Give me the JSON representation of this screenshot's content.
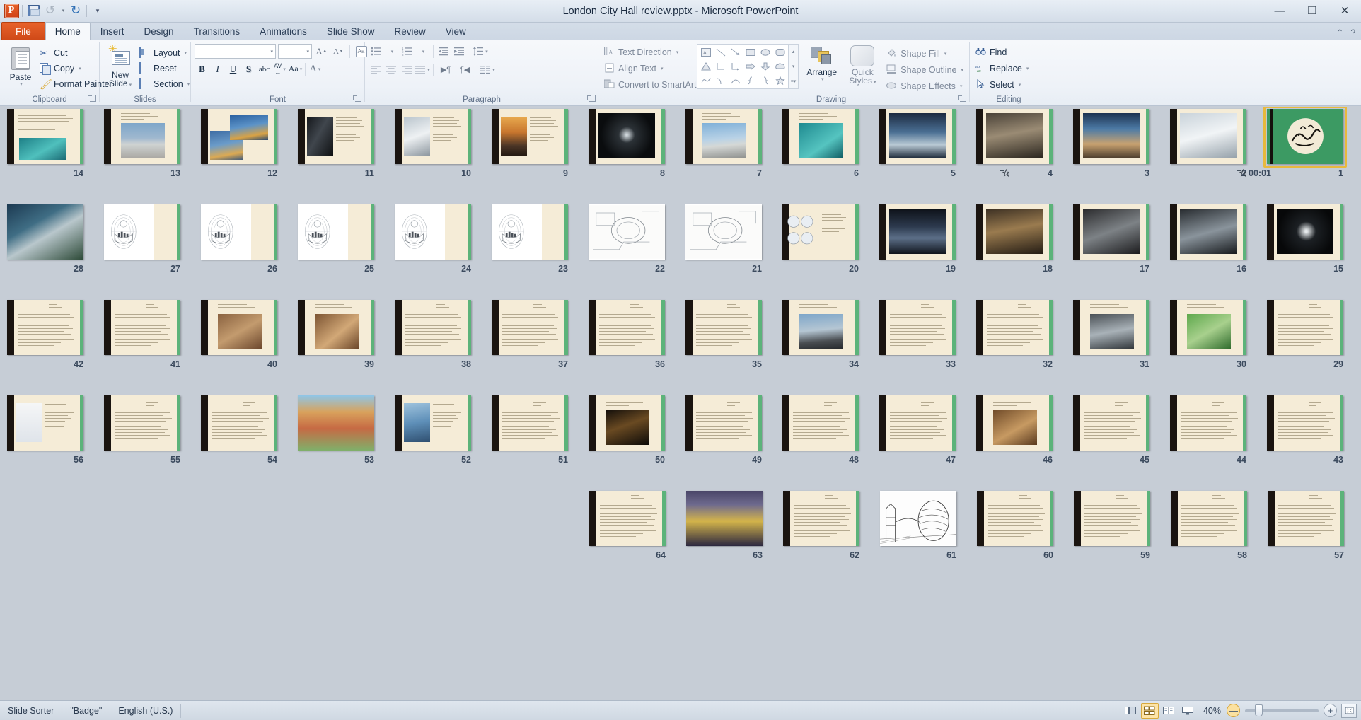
{
  "window": {
    "title": "London City Hall review.pptx  -  Microsoft PowerPoint",
    "minimize": "—",
    "restore": "❐",
    "close": "✕"
  },
  "quick_access": {
    "app_logo": "P",
    "save": "save-icon",
    "undo": "↺",
    "redo": "↻",
    "customize": "▾"
  },
  "tabs": [
    {
      "label": "File",
      "kind": "file"
    },
    {
      "label": "Home",
      "kind": "active"
    },
    {
      "label": "Insert",
      "kind": "normal"
    },
    {
      "label": "Design",
      "kind": "normal"
    },
    {
      "label": "Transitions",
      "kind": "normal"
    },
    {
      "label": "Animations",
      "kind": "normal"
    },
    {
      "label": "Slide Show",
      "kind": "normal"
    },
    {
      "label": "Review",
      "kind": "normal"
    },
    {
      "label": "View",
      "kind": "normal"
    }
  ],
  "tab_right": {
    "minimize_ribbon": "⌃",
    "help": "?"
  },
  "ribbon": {
    "clipboard": {
      "label": "Clipboard",
      "paste": "Paste",
      "paste_caret": "▾",
      "cut": "Cut",
      "copy": "Copy",
      "format_painter": "Format Painter"
    },
    "slides": {
      "label": "Slides",
      "new_slide": "New\nSlide",
      "new_slide_line1": "New",
      "new_slide_line2": "Slide",
      "layout": "Layout",
      "reset": "Reset",
      "section": "Section"
    },
    "font": {
      "label": "Font",
      "font_name": "",
      "font_size": "",
      "grow": "A",
      "shrink": "A",
      "clear_formatting": "Aa",
      "bold": "B",
      "italic": "I",
      "underline": "U",
      "shadow": "S",
      "strikethrough": "abc",
      "character_spacing": "AV",
      "change_case": "Aa",
      "font_color": "A"
    },
    "paragraph": {
      "label": "Paragraph",
      "bullets": "bullets-icon",
      "numbering": "numbering-icon",
      "decrease_indent": "decrease-indent-icon",
      "increase_indent": "increase-indent-icon",
      "line_spacing": "line-spacing-icon",
      "align_left": "align-left-icon",
      "align_center": "align-center-icon",
      "align_right": "align-right-icon",
      "justify": "justify-icon",
      "ltr": "▶¶",
      "rtl": "¶◀",
      "columns": "columns-icon",
      "text_direction": "Text Direction",
      "align_text": "Align Text",
      "convert_to_smartart": "Convert to SmartArt"
    },
    "drawing": {
      "label": "Drawing",
      "shapes": [
        "▭",
        "╲",
        "↘",
        "▢",
        "⬭",
        "▢",
        "△",
        "⌐",
        "⌐",
        "⇨",
        "⇩",
        "☁",
        "∿",
        "⌒",
        "{",
        "}",
        "☆",
        "◇"
      ],
      "scroll_up": "▴",
      "scroll_down": "▾",
      "scroll_more": "▾",
      "arrange": "Arrange",
      "quick_styles_line1": "Quick",
      "quick_styles_line2": "Styles",
      "shape_fill": "Shape Fill",
      "shape_outline": "Shape Outline",
      "shape_effects": "Shape Effects"
    },
    "editing": {
      "label": "Editing",
      "find": "Find",
      "replace": "Replace",
      "select": "Select"
    }
  },
  "status_bar": {
    "view_name": "Slide Sorter",
    "theme": "\"Badge\"",
    "language": "English (U.S.)",
    "views": [
      {
        "name": "normal-view",
        "glyph": "▯▤",
        "active": false
      },
      {
        "name": "slide-sorter-view",
        "glyph": "▦",
        "active": true
      },
      {
        "name": "reading-view",
        "glyph": "▤",
        "active": false
      },
      {
        "name": "slide-show-view",
        "glyph": "▭",
        "active": false
      }
    ],
    "zoom_level": "40%",
    "zoom_out": "—",
    "zoom_in": "+",
    "fit_to_window": "⤢"
  },
  "slide_sorter": {
    "selected_slide": 1,
    "selected_timing": "00:01",
    "transition_icon": "✦",
    "slides": [
      {
        "n": 14,
        "type": "text-image",
        "img": "teal",
        "imgpos": "bottom"
      },
      {
        "n": 13,
        "type": "text-image",
        "img": "cityhall-day",
        "imgpos": "center"
      },
      {
        "n": 12,
        "type": "text-image",
        "img": "cityhall-blue",
        "imgpos": "split"
      },
      {
        "n": 11,
        "type": "text-image",
        "img": "steel-dark",
        "imgpos": "left"
      },
      {
        "n": 10,
        "type": "text-image",
        "img": "glass-egg",
        "imgpos": "left"
      },
      {
        "n": 9,
        "type": "text-image",
        "img": "sunset-walk",
        "imgpos": "left"
      },
      {
        "n": 8,
        "type": "image-dark",
        "img": "spiral-dark",
        "imgpos": "center"
      },
      {
        "n": 7,
        "type": "text-image",
        "img": "cityhall-sky",
        "imgpos": "center"
      },
      {
        "n": 6,
        "type": "text-image",
        "img": "teal-plan",
        "imgpos": "center"
      },
      {
        "n": 5,
        "type": "image-dark",
        "img": "cityhall-night",
        "imgpos": "center"
      },
      {
        "n": 4,
        "type": "image-dark",
        "img": "interior-hall",
        "imgpos": "center"
      },
      {
        "n": 3,
        "type": "image-dark",
        "img": "bridge-sky",
        "imgpos": "center"
      },
      {
        "n": 2,
        "type": "image-dark",
        "img": "interior-white",
        "imgpos": "center"
      },
      {
        "n": 1,
        "type": "title-green",
        "img": "calligraphy",
        "imgpos": "center"
      },
      {
        "n": 28,
        "type": "image-full",
        "img": "aerial-dome",
        "imgpos": "full"
      },
      {
        "n": 27,
        "type": "diagram",
        "img": "wire-1",
        "imgpos": "left"
      },
      {
        "n": 26,
        "type": "diagram",
        "img": "wire-2",
        "imgpos": "left"
      },
      {
        "n": 25,
        "type": "diagram",
        "img": "wire-3",
        "imgpos": "left"
      },
      {
        "n": 24,
        "type": "diagram",
        "img": "wire-4",
        "imgpos": "left"
      },
      {
        "n": 23,
        "type": "diagram",
        "img": "wire-5",
        "imgpos": "left"
      },
      {
        "n": 22,
        "type": "plan",
        "img": "site-plan",
        "imgpos": "full"
      },
      {
        "n": 21,
        "type": "plan",
        "img": "axon-plan",
        "imgpos": "full"
      },
      {
        "n": 20,
        "type": "text-image",
        "img": "circles",
        "imgpos": "left"
      },
      {
        "n": 19,
        "type": "image-dark",
        "img": "auditorium",
        "imgpos": "center"
      },
      {
        "n": 18,
        "type": "image-dark",
        "img": "interior-warm",
        "imgpos": "center"
      },
      {
        "n": 17,
        "type": "image-dark",
        "img": "stair-interior",
        "imgpos": "center"
      },
      {
        "n": 16,
        "type": "image-dark",
        "img": "ramp-interior",
        "imgpos": "center"
      },
      {
        "n": 15,
        "type": "image-dark",
        "img": "spiral-black",
        "imgpos": "center"
      },
      {
        "n": 42,
        "type": "text",
        "img": "",
        "imgpos": ""
      },
      {
        "n": 41,
        "type": "text",
        "img": "",
        "imgpos": ""
      },
      {
        "n": 40,
        "type": "text-image",
        "img": "brown-model",
        "imgpos": "center"
      },
      {
        "n": 39,
        "type": "text-image",
        "img": "brown-wood",
        "imgpos": "center"
      },
      {
        "n": 38,
        "type": "text",
        "img": "",
        "imgpos": ""
      },
      {
        "n": 37,
        "type": "text",
        "img": "",
        "imgpos": ""
      },
      {
        "n": 36,
        "type": "text",
        "img": "",
        "imgpos": ""
      },
      {
        "n": 35,
        "type": "text",
        "img": "",
        "imgpos": ""
      },
      {
        "n": 34,
        "type": "text-image",
        "img": "cityhall-grey",
        "imgpos": "center"
      },
      {
        "n": 33,
        "type": "text",
        "img": "",
        "imgpos": ""
      },
      {
        "n": 32,
        "type": "text",
        "img": "",
        "imgpos": ""
      },
      {
        "n": 31,
        "type": "text-image",
        "img": "interior-photo",
        "imgpos": "center"
      },
      {
        "n": 30,
        "type": "text-image",
        "img": "green-render",
        "imgpos": "center"
      },
      {
        "n": 29,
        "type": "text",
        "img": "",
        "imgpos": ""
      },
      {
        "n": 56,
        "type": "text-image",
        "img": "section-draw",
        "imgpos": "left"
      },
      {
        "n": 55,
        "type": "text",
        "img": "",
        "imgpos": ""
      },
      {
        "n": 54,
        "type": "text",
        "img": "",
        "imgpos": ""
      },
      {
        "n": 53,
        "type": "image-full",
        "img": "dome-illus",
        "imgpos": "full"
      },
      {
        "n": 52,
        "type": "text-image",
        "img": "tower-blue",
        "imgpos": "left"
      },
      {
        "n": 51,
        "type": "text",
        "img": "",
        "imgpos": ""
      },
      {
        "n": 50,
        "type": "text-image",
        "img": "night-corridor",
        "imgpos": "center"
      },
      {
        "n": 49,
        "type": "text",
        "img": "",
        "imgpos": ""
      },
      {
        "n": 48,
        "type": "text",
        "img": "",
        "imgpos": ""
      },
      {
        "n": 47,
        "type": "text",
        "img": "",
        "imgpos": ""
      },
      {
        "n": 46,
        "type": "text-image",
        "img": "wood-ceiling",
        "imgpos": "center"
      },
      {
        "n": 45,
        "type": "text",
        "img": "",
        "imgpos": ""
      },
      {
        "n": 44,
        "type": "text",
        "img": "",
        "imgpos": ""
      },
      {
        "n": 43,
        "type": "text",
        "img": "",
        "imgpos": ""
      },
      {
        "n": 64,
        "type": "text",
        "img": "",
        "imgpos": ""
      },
      {
        "n": 63,
        "type": "image-full",
        "img": "cityhall-dusk",
        "imgpos": "full"
      },
      {
        "n": 62,
        "type": "text",
        "img": "",
        "imgpos": ""
      },
      {
        "n": 61,
        "type": "plan",
        "img": "sketch-bridge",
        "imgpos": "full"
      },
      {
        "n": 60,
        "type": "text",
        "img": "",
        "imgpos": ""
      },
      {
        "n": 59,
        "type": "text",
        "img": "",
        "imgpos": ""
      },
      {
        "n": 58,
        "type": "text",
        "img": "",
        "imgpos": ""
      },
      {
        "n": 57,
        "type": "text",
        "img": "",
        "imgpos": ""
      }
    ]
  }
}
